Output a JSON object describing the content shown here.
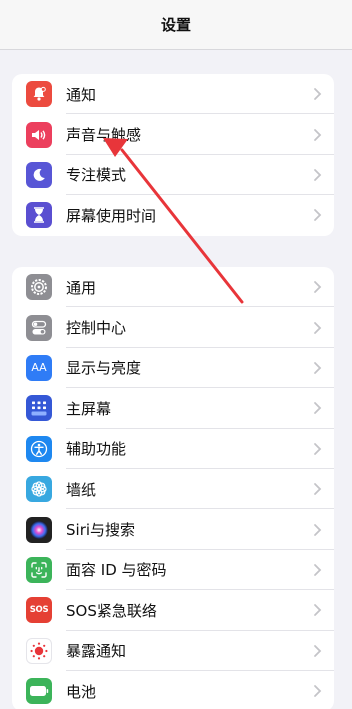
{
  "nav": {
    "title": "设置"
  },
  "group1": [
    {
      "label": "通知",
      "color": "#ec4b3f",
      "icon": "bell-icon"
    },
    {
      "label": "声音与触感",
      "color": "#ec3f5d",
      "icon": "speaker-icon"
    },
    {
      "label": "专注模式",
      "color": "#5856d6",
      "icon": "moon-icon"
    },
    {
      "label": "屏幕使用时间",
      "color": "#5a4fd1",
      "icon": "hourglass-icon"
    }
  ],
  "group2": [
    {
      "label": "通用",
      "color": "#8e8e93",
      "icon": "gear-icon"
    },
    {
      "label": "控制中心",
      "color": "#8e8e93",
      "icon": "toggles-icon"
    },
    {
      "label": "显示与亮度",
      "color": "#2f7cf6",
      "icon": "text-size-icon",
      "icon_text": "AA"
    },
    {
      "label": "主屏幕",
      "color": "#3558d6",
      "icon": "home-grid-icon"
    },
    {
      "label": "辅助功能",
      "color": "#1e88f0",
      "icon": "accessibility-icon"
    },
    {
      "label": "墙纸",
      "color": "#38a8e0",
      "icon": "flower-icon"
    },
    {
      "label": "Siri与搜索",
      "color": "#222222",
      "icon": "siri-icon"
    },
    {
      "label": "面容 ID 与密码",
      "color": "#3cb45a",
      "icon": "face-id-icon"
    },
    {
      "label": "SOS紧急联络",
      "color": "#e54034",
      "icon": "sos-icon",
      "icon_text": "SOS"
    },
    {
      "label": "暴露通知",
      "color": "#ffffff",
      "icon": "exposure-icon"
    },
    {
      "label": "电池",
      "color": "#3cb45a",
      "icon": "battery-icon"
    }
  ],
  "annotation": {
    "color": "#e8353a"
  }
}
